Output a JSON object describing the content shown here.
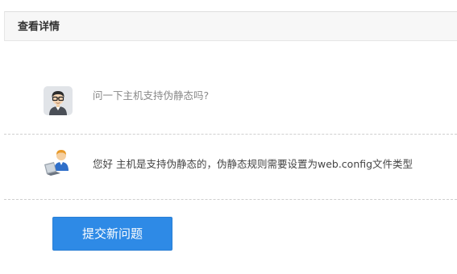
{
  "panel": {
    "title": "查看详情"
  },
  "question": {
    "avatar_icon": "user-with-glasses-icon",
    "text": "问一下主机支持伪静态吗?"
  },
  "answer": {
    "avatar_icon": "support-agent-laptop-icon",
    "text": "您好 主机是支持伪静态的，伪静态规则需要设置为web.config文件类型"
  },
  "actions": {
    "submit_label": "提交新问题"
  },
  "colors": {
    "accent": "#2e8ae6",
    "header_bg": "#f7f7f7",
    "question_text": "#888888",
    "answer_text": "#444444"
  }
}
